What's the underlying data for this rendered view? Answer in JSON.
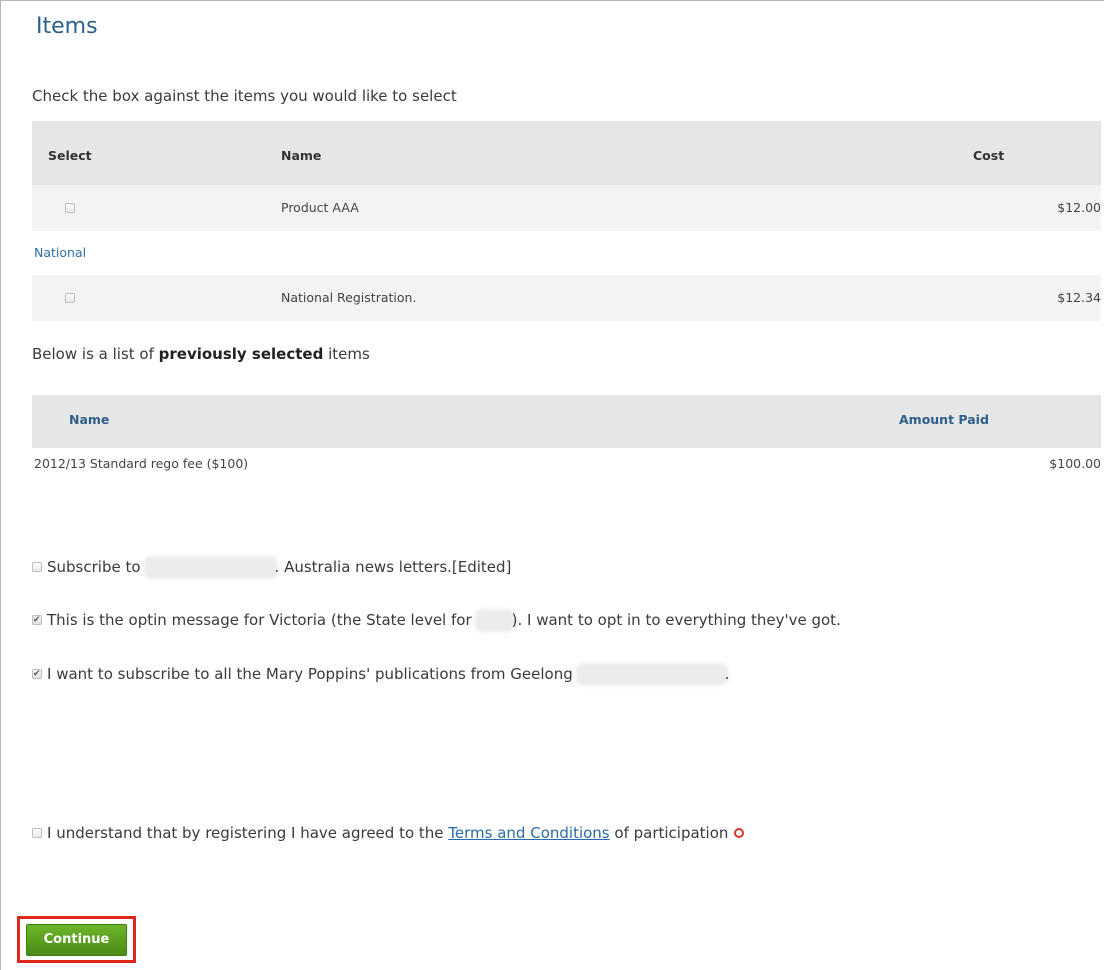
{
  "page": {
    "title": "Items",
    "instruction": "Check the box against the items you would like to select"
  },
  "items_table": {
    "columns": {
      "select": "Select",
      "name": "Name",
      "cost": "Cost"
    },
    "rows": [
      {
        "name": "Product AAA",
        "cost": "$12.00",
        "checked": false
      }
    ],
    "section_label": "National",
    "section_rows": [
      {
        "name": "National Registration.",
        "cost": "$12.34",
        "checked": false
      }
    ]
  },
  "previous": {
    "text_before": "Below is a list of ",
    "text_bold": "previously selected",
    "text_after": " items",
    "columns": {
      "name": "Name",
      "amount": "Amount Paid"
    },
    "rows": [
      {
        "name": "2012/13 Standard rego fee ($100)",
        "amount": "$100.00"
      }
    ]
  },
  "optins": [
    {
      "before": "Subscribe to",
      "after": ". Australia news letters.[Edited]",
      "checked": false
    },
    {
      "before": "This is the optin message for Victoria (the State level for",
      "after": "). I want to opt in to everything they've got.",
      "checked": true
    },
    {
      "before": "I want to subscribe to all the Mary Poppins' publications from Geelong",
      "after": ".",
      "checked": true
    }
  ],
  "terms": {
    "before": "I understand that by registering I have agreed to the ",
    "link": "Terms and Conditions",
    "after": " of participation",
    "checked": false
  },
  "continue_label": "Continue",
  "colors": {
    "title": "#2d5f8b",
    "link": "#2b6aa8",
    "button": "#5a9e1f",
    "highlight": "#e0261b",
    "required": "#e0342a"
  }
}
